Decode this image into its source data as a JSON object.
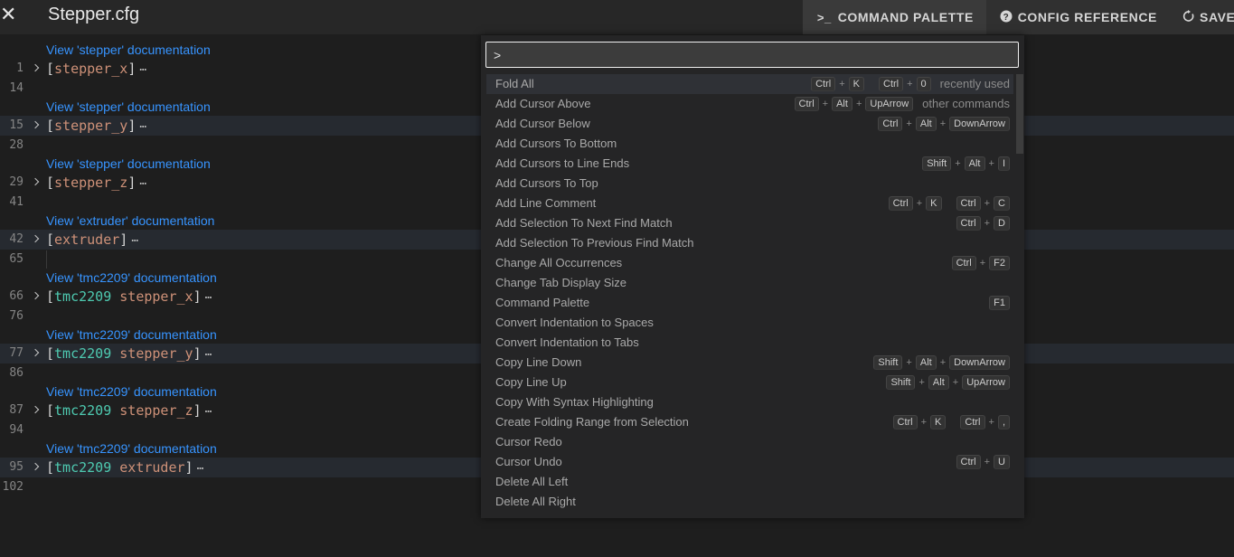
{
  "window": {
    "close_glyph": "✕",
    "file_title": "Stepper.cfg"
  },
  "toolbar": {
    "command_palette": "COMMAND PALETTE",
    "config_reference": "CONFIG REFERENCE",
    "save": "SAVE"
  },
  "editor": {
    "blocks": [
      {
        "lens": "View 'stepper' documentation",
        "line": "1",
        "prefix": "",
        "name": "stepper_x",
        "end_line": "14"
      },
      {
        "lens": "View 'stepper' documentation",
        "line": "15",
        "prefix": "",
        "name": "stepper_y",
        "end_line": "28"
      },
      {
        "lens": "View 'stepper' documentation",
        "line": "29",
        "prefix": "",
        "name": "stepper_z",
        "end_line": "41"
      },
      {
        "lens": "View 'extruder' documentation",
        "line": "42",
        "prefix": "",
        "name": "extruder",
        "end_line": "65"
      },
      {
        "lens": "View 'tmc2209' documentation",
        "line": "66",
        "prefix": "tmc2209",
        "name": "stepper_x",
        "end_line": "76"
      },
      {
        "lens": "View 'tmc2209' documentation",
        "line": "77",
        "prefix": "tmc2209",
        "name": "stepper_y",
        "end_line": "86"
      },
      {
        "lens": "View 'tmc2209' documentation",
        "line": "87",
        "prefix": "tmc2209",
        "name": "stepper_z",
        "end_line": "94"
      },
      {
        "lens": "View 'tmc2209' documentation",
        "line": "95",
        "prefix": "tmc2209",
        "name": "extruder",
        "end_line": "102"
      }
    ],
    "ellipsis": "⋯"
  },
  "palette": {
    "input_value": ">",
    "items": [
      {
        "label": "Fold All",
        "keys": [
          [
            "Ctrl",
            "K"
          ],
          [
            "Ctrl",
            "0"
          ]
        ],
        "note": "recently used"
      },
      {
        "label": "Add Cursor Above",
        "keys": [
          [
            "Ctrl",
            "Alt",
            "UpArrow"
          ]
        ],
        "note": "other commands"
      },
      {
        "label": "Add Cursor Below",
        "keys": [
          [
            "Ctrl",
            "Alt",
            "DownArrow"
          ]
        ],
        "note": ""
      },
      {
        "label": "Add Cursors To Bottom",
        "keys": [],
        "note": ""
      },
      {
        "label": "Add Cursors to Line Ends",
        "keys": [
          [
            "Shift",
            "Alt",
            "I"
          ]
        ],
        "note": ""
      },
      {
        "label": "Add Cursors To Top",
        "keys": [],
        "note": ""
      },
      {
        "label": "Add Line Comment",
        "keys": [
          [
            "Ctrl",
            "K"
          ],
          [
            "Ctrl",
            "C"
          ]
        ],
        "note": ""
      },
      {
        "label": "Add Selection To Next Find Match",
        "keys": [
          [
            "Ctrl",
            "D"
          ]
        ],
        "note": ""
      },
      {
        "label": "Add Selection To Previous Find Match",
        "keys": [],
        "note": ""
      },
      {
        "label": "Change All Occurrences",
        "keys": [
          [
            "Ctrl",
            "F2"
          ]
        ],
        "note": ""
      },
      {
        "label": "Change Tab Display Size",
        "keys": [],
        "note": ""
      },
      {
        "label": "Command Palette",
        "keys": [
          [
            "F1"
          ]
        ],
        "note": ""
      },
      {
        "label": "Convert Indentation to Spaces",
        "keys": [],
        "note": ""
      },
      {
        "label": "Convert Indentation to Tabs",
        "keys": [],
        "note": ""
      },
      {
        "label": "Copy Line Down",
        "keys": [
          [
            "Shift",
            "Alt",
            "DownArrow"
          ]
        ],
        "note": ""
      },
      {
        "label": "Copy Line Up",
        "keys": [
          [
            "Shift",
            "Alt",
            "UpArrow"
          ]
        ],
        "note": ""
      },
      {
        "label": "Copy With Syntax Highlighting",
        "keys": [],
        "note": ""
      },
      {
        "label": "Create Folding Range from Selection",
        "keys": [
          [
            "Ctrl",
            "K"
          ],
          [
            "Ctrl",
            ","
          ]
        ],
        "note": ""
      },
      {
        "label": "Cursor Redo",
        "keys": [],
        "note": ""
      },
      {
        "label": "Cursor Undo",
        "keys": [
          [
            "Ctrl",
            "U"
          ]
        ],
        "note": ""
      },
      {
        "label": "Delete All Left",
        "keys": [],
        "note": ""
      },
      {
        "label": "Delete All Right",
        "keys": [],
        "note": ""
      }
    ]
  }
}
